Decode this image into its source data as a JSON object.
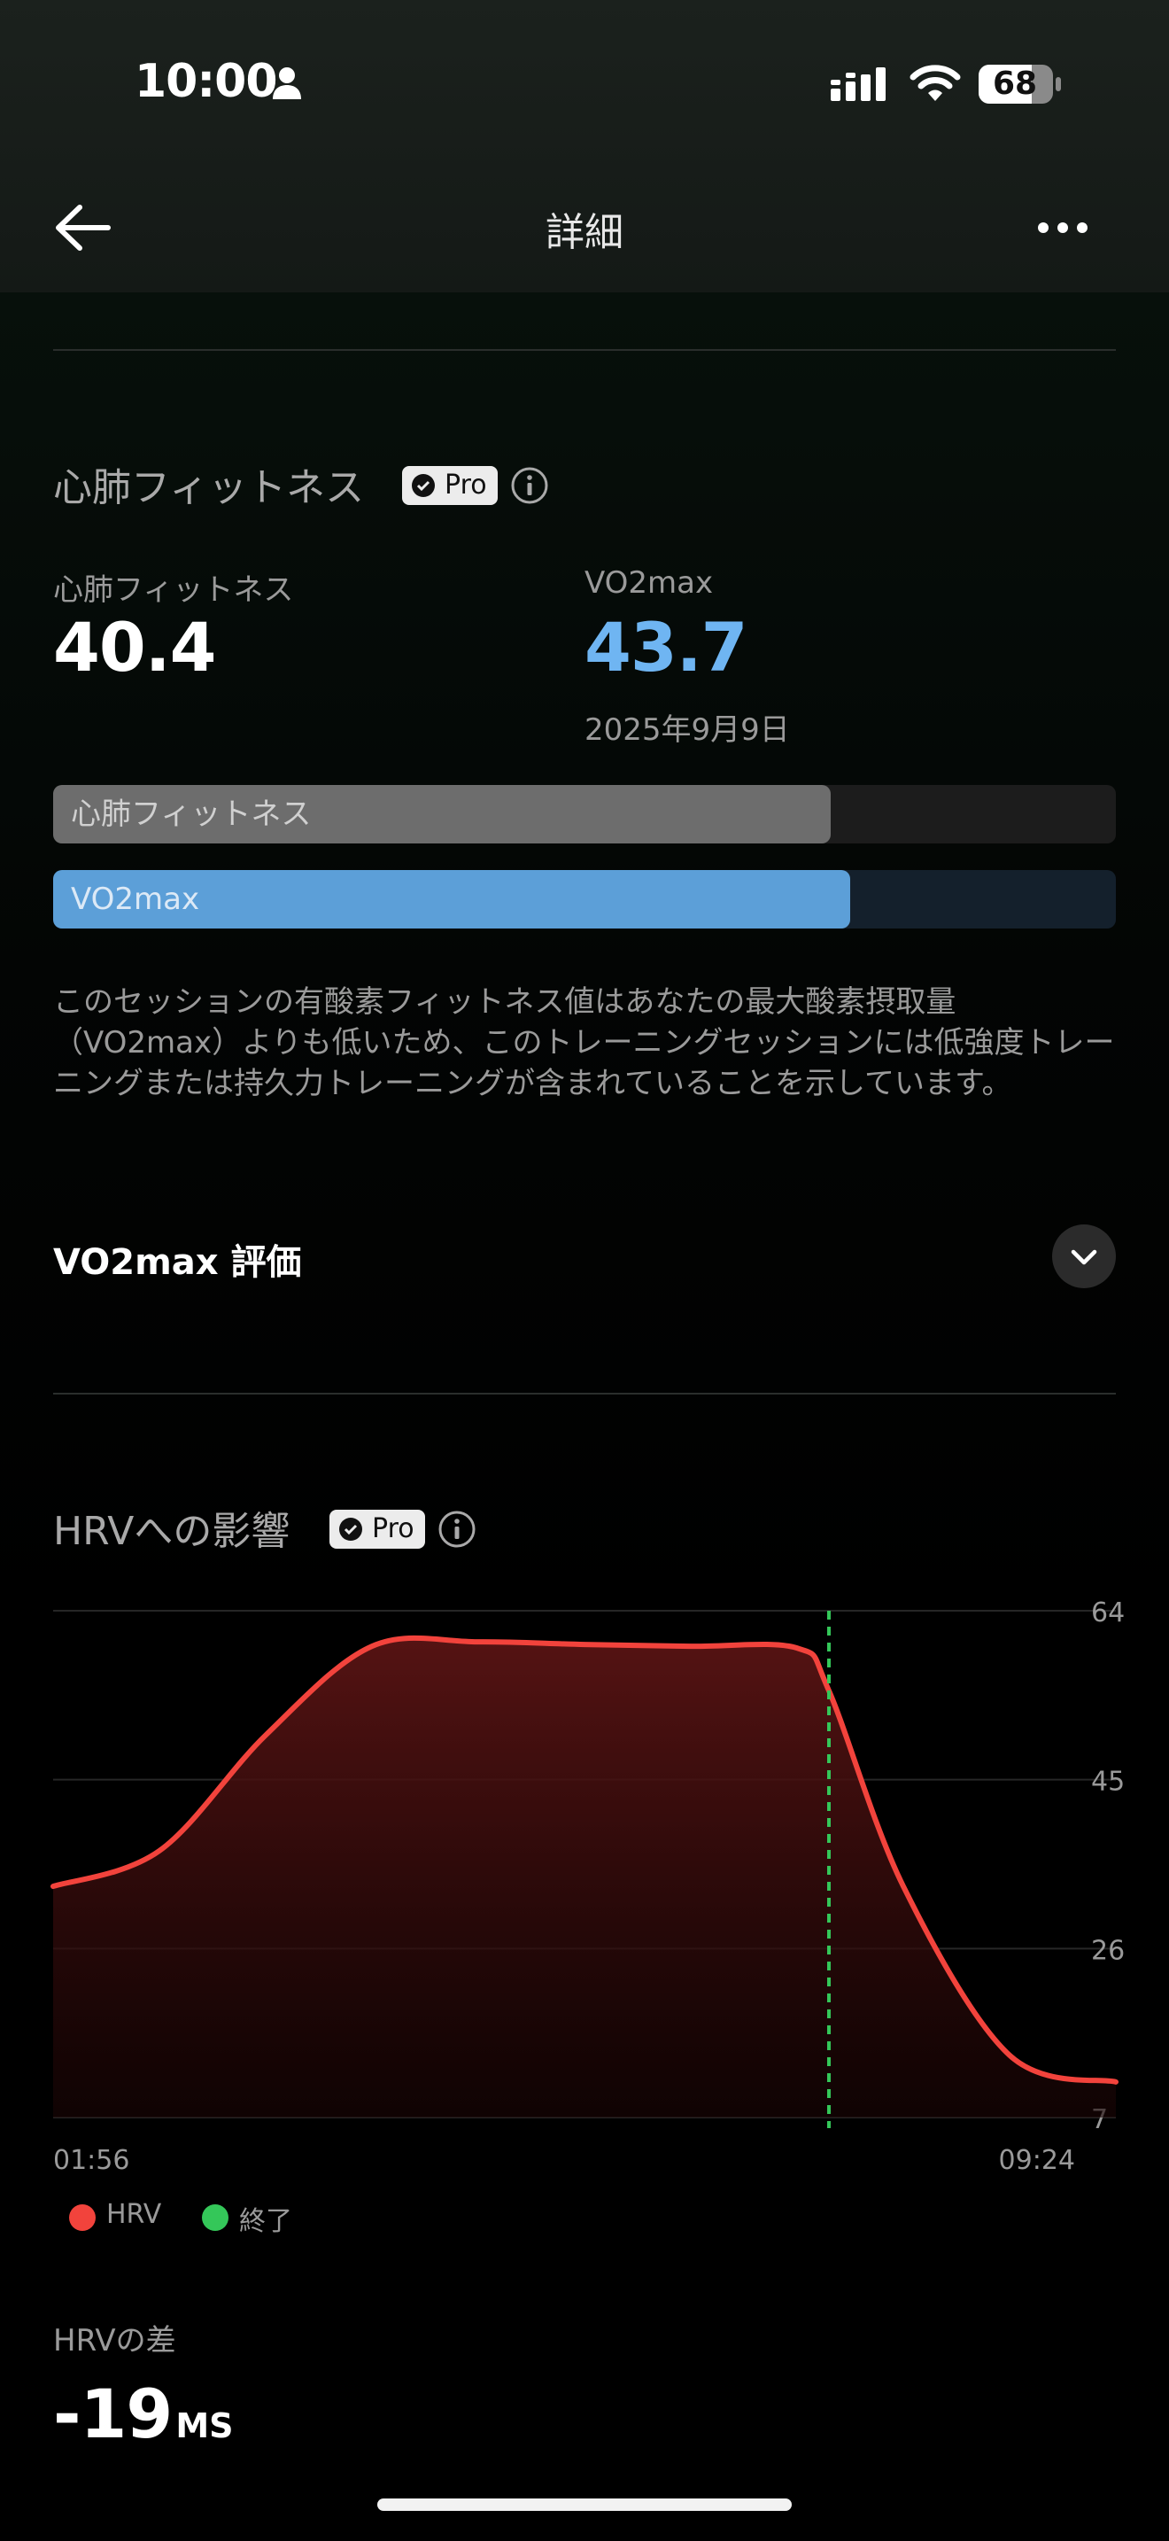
{
  "status_bar": {
    "time": "10:00",
    "battery": "68"
  },
  "nav": {
    "title": "詳細"
  },
  "cardio": {
    "title": "心肺フィットネス",
    "pro_label": "Pro",
    "fitness_label": "心肺フィットネス",
    "fitness_value": "40.4",
    "vo2_label": "VO2max",
    "vo2_value": "43.7",
    "vo2_date": "2025年9月9日",
    "bars": [
      {
        "label": "心肺フィットネス",
        "fraction": 0.732
      },
      {
        "label": "VO2max",
        "fraction": 0.75
      }
    ],
    "description": "このセッションの有酸素フィットネス値はあなたの最大酸素摂取量（VO2max）よりも低いため、このトレーニングセッションには低強度トレーニングまたは持久力トレーニングが含まれていることを示しています。",
    "rating_label": "VO2max 評価"
  },
  "hrv": {
    "title": "HRVへの影響",
    "pro_label": "Pro",
    "legend": {
      "hrv": "HRV",
      "end": "終了"
    },
    "diff_label": "HRVの差",
    "diff_value": "-19",
    "diff_unit": "MS"
  },
  "chart_data": {
    "type": "area",
    "series": [
      {
        "name": "HRV",
        "x": [
          0,
          0.1,
          0.2,
          0.3,
          0.4,
          0.5,
          0.6,
          0.7,
          0.73,
          0.8,
          0.9,
          1.0
        ],
        "values": [
          33,
          37,
          50,
          60,
          60.5,
          60.2,
          60,
          59.8,
          55,
          33,
          14,
          11
        ]
      }
    ],
    "x_tick_labels": [
      "01:56",
      "09:24"
    ],
    "y_ticks": [
      64,
      45,
      26,
      7
    ],
    "ylim": [
      7,
      64
    ],
    "end_marker_x": 0.73,
    "colors": {
      "line": "#f2433c",
      "end_marker": "#34c759"
    },
    "grid": true
  },
  "colors": {
    "vo2_accent": "#6fb5f2",
    "fitness_bar": "#6d6d6d",
    "vo2_bar": "#5c9fd8",
    "hrv": "#f2433c",
    "end": "#34c759"
  }
}
